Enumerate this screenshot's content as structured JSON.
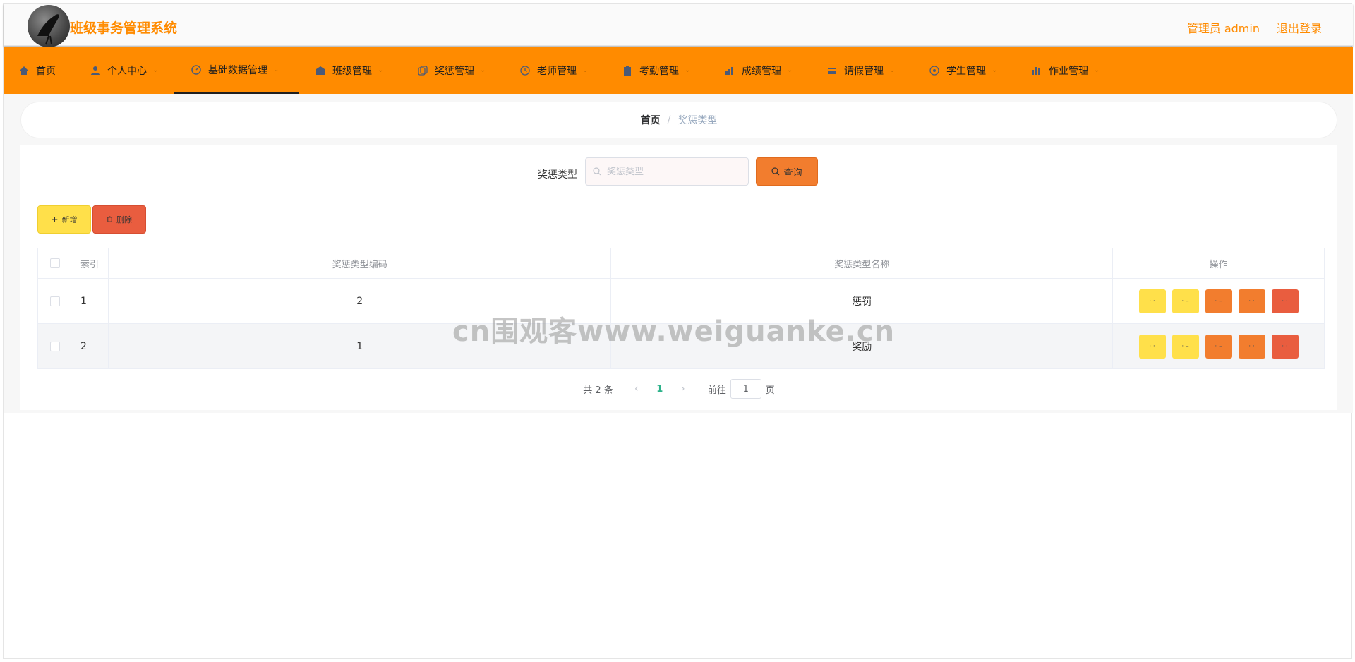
{
  "header": {
    "title": "班级事务管理系统",
    "user_label": "管理员 admin",
    "logout_label": "退出登录"
  },
  "nav": {
    "items": [
      {
        "label": "首页",
        "icon": "home-icon",
        "has_menu": false
      },
      {
        "label": "个人中心",
        "icon": "user-icon",
        "has_menu": true
      },
      {
        "label": "基础数据管理",
        "icon": "dashboard-icon",
        "has_menu": true,
        "active": true
      },
      {
        "label": "班级管理",
        "icon": "building-icon",
        "has_menu": true
      },
      {
        "label": "奖惩管理",
        "icon": "copy-icon",
        "has_menu": true
      },
      {
        "label": "老师管理",
        "icon": "clock-icon",
        "has_menu": true
      },
      {
        "label": "考勤管理",
        "icon": "clipboard-icon",
        "has_menu": true
      },
      {
        "label": "成绩管理",
        "icon": "chart-icon",
        "has_menu": true
      },
      {
        "label": "请假管理",
        "icon": "card-icon",
        "has_menu": true
      },
      {
        "label": "学生管理",
        "icon": "target-icon",
        "has_menu": true
      },
      {
        "label": "作业管理",
        "icon": "bar-chart-icon",
        "has_menu": true
      }
    ]
  },
  "breadcrumb": {
    "home": "首页",
    "separator": "/",
    "current": "奖惩类型"
  },
  "search": {
    "label": "奖惩类型",
    "placeholder": "奖惩类型",
    "value": "",
    "button_label": "查询"
  },
  "toolbar": {
    "add_label": "新增",
    "delete_label": "删除"
  },
  "table": {
    "headers": {
      "index": "索引",
      "code": "奖惩类型编码",
      "name": "奖惩类型名称",
      "ops": "操作"
    },
    "rows": [
      {
        "index": "1",
        "code": "2",
        "name": "惩罚"
      },
      {
        "index": "2",
        "code": "1",
        "name": "奖励"
      }
    ]
  },
  "pagination": {
    "total_text": "共 2 条",
    "current_page": "1",
    "goto_label": "前往",
    "goto_value": "1",
    "page_suffix": "页"
  },
  "watermark": "cn围观客www.weiguanke.cn",
  "colors": {
    "brand_orange": "#ff8b00",
    "yellow_button": "#ffe04a",
    "orange_button": "#f27d2e",
    "red_button": "#e95d3f",
    "page_active": "#2db28a"
  }
}
